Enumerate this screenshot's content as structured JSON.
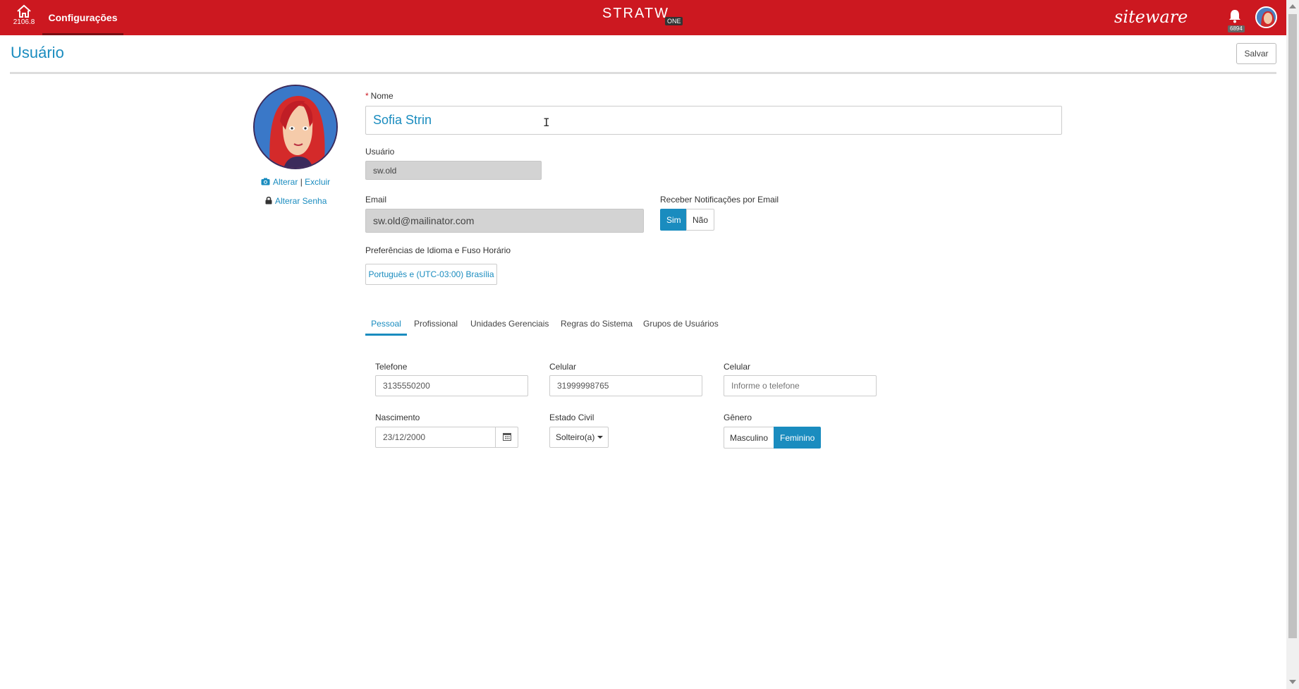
{
  "topbar": {
    "version": "2106.8",
    "active_tab": "Configurações",
    "brand": "STRATW",
    "brand_suffix": "ONE",
    "partner": "siteware",
    "notifications_count": "6894",
    "color": "#cc1820"
  },
  "page": {
    "title": "Usuário",
    "save_label": "Salvar"
  },
  "profile": {
    "change_photo": "Alterar",
    "separator": "|",
    "delete_photo": "Excluir",
    "change_password": "Alterar Senha"
  },
  "form": {
    "name_required_mark": "*",
    "name_label": "Nome",
    "name_value": "Sofia Strin",
    "user_label": "Usuário",
    "user_value": "sw.old",
    "email_label": "Email",
    "email_value": "sw.old@mailinator.com",
    "notify_label": "Receber Notificações por Email",
    "notify_yes": "Sim",
    "notify_no": "Não",
    "notify_selected": "Sim",
    "lang_label": "Preferências de Idioma e Fuso Horário",
    "lang_value": "Português e (UTC-03:00) Brasília"
  },
  "tabs": [
    {
      "label": "Pessoal",
      "active": true
    },
    {
      "label": "Profissional",
      "active": false
    },
    {
      "label": "Unidades Gerenciais",
      "active": false
    },
    {
      "label": "Regras do Sistema",
      "active": false
    },
    {
      "label": "Grupos de Usuários",
      "active": false
    }
  ],
  "personal": {
    "phone_label": "Telefone",
    "phone_value": "3135550200",
    "mobile_label": "Celular",
    "mobile_value": "31999998765",
    "mobile2_label": "Celular",
    "mobile2_placeholder": "Informe o telefone",
    "birth_label": "Nascimento",
    "birth_value": "23/12/2000",
    "civil_label": "Estado Civil",
    "civil_value": "Solteiro(a)",
    "gender_label": "Gênero",
    "gender_male": "Masculino",
    "gender_female": "Feminino",
    "gender_selected": "Feminino"
  },
  "icons": [
    "home-icon",
    "bell-icon",
    "camera-icon",
    "lock-icon",
    "calendar-icon",
    "text-cursor-icon"
  ],
  "accent": "#1a8cbf"
}
